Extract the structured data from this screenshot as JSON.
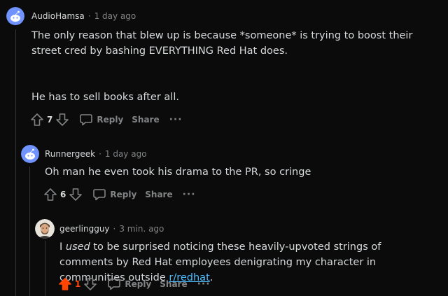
{
  "comments": [
    {
      "author": "AudioHamsa",
      "separator": "·",
      "time": "1 day ago",
      "body": [
        "The only reason that blew up is because *someone* is trying to boost their street cred by bashing EVERYTHING Red Hat does.",
        "He has to sell books after all."
      ],
      "score": "7",
      "reply_label": "Reply",
      "share_label": "Share",
      "more_label": "···"
    },
    {
      "author": "Runnergeek",
      "separator": "·",
      "time": "1 day ago",
      "body": [
        "Oh man he even took his drama to the PR, so cringe"
      ],
      "score": "6",
      "reply_label": "Reply",
      "share_label": "Share",
      "more_label": "···"
    },
    {
      "author": "geerlingguy",
      "separator": "·",
      "time": "3 min. ago",
      "body_prefix": "I ",
      "body_em": "used",
      "body_mid": " to be surprised noticing these heavily-upvoted strings of comments by Red Hat employees denigrating my character in communities outside ",
      "body_link": "r/redhat",
      "body_suffix": ".",
      "score": "1",
      "reply_label": "Reply",
      "share_label": "Share",
      "more_label": "···"
    }
  ],
  "colors": {
    "background": "#0b0b0b",
    "text": "#d7dadc",
    "meta": "#818384",
    "upvoted": "#ff4500",
    "link": "#4fbcff",
    "avatar_blue": "#7193ff"
  }
}
